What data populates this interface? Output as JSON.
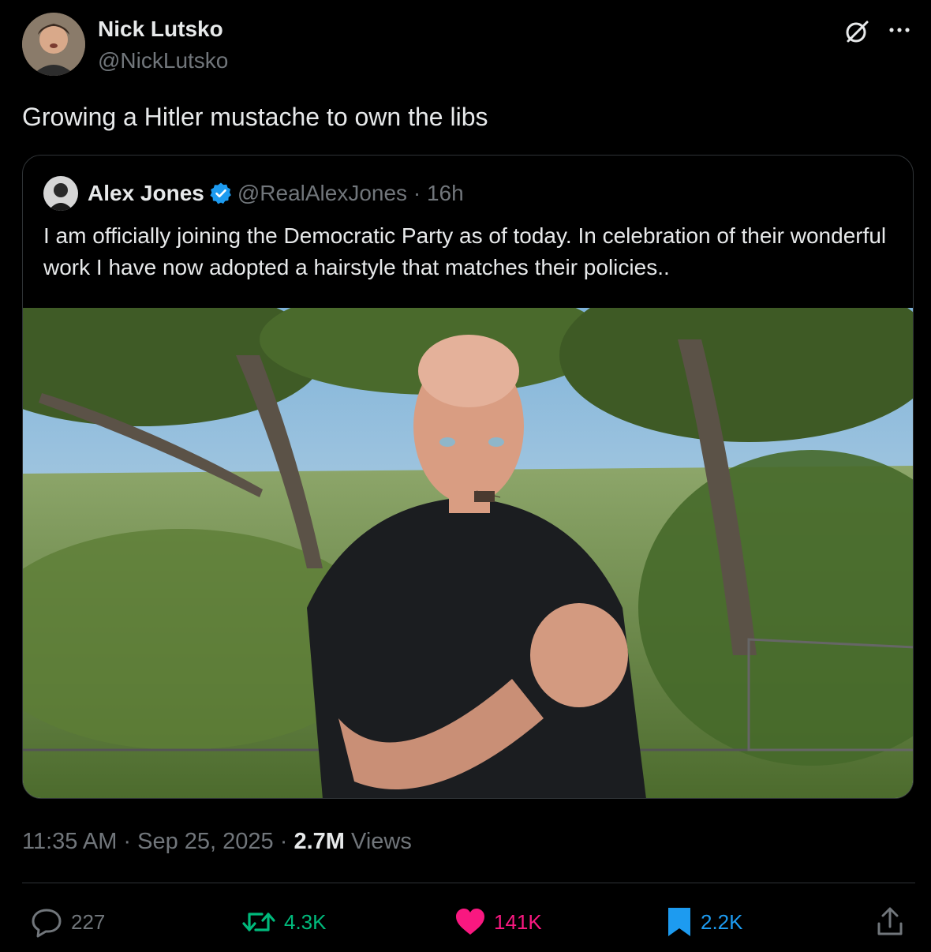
{
  "tweet": {
    "author_name": "Nick Lutsko",
    "author_handle": "@NickLutsko",
    "text": "Growing a Hitler mustache to own the libs",
    "timestamp": "11:35 AM · Sep 25, 2025 · ",
    "views_count": "2.7M",
    "views_label": " Views"
  },
  "quote": {
    "author_name": "Alex Jones",
    "author_handle": "@RealAlexJones",
    "separator": "·",
    "time": "16h",
    "text": "I am officially joining the Democratic Party as of today.  In celebration of their wonderful work I have now adopted a hairstyle that matches their policies.."
  },
  "actions": {
    "reply_count": "227",
    "retweet_count": "4.3K",
    "like_count": "141K",
    "bookmark_count": "2.2K"
  },
  "icons": {
    "grok": "grok-icon",
    "more": "more-icon",
    "verified": "verified-badge-icon",
    "reply": "reply-icon",
    "retweet": "retweet-icon",
    "like": "heart-icon",
    "bookmark": "bookmark-icon",
    "share": "share-icon"
  },
  "colors": {
    "background": "#000000",
    "text": "#e7e9ea",
    "muted": "#71767b",
    "retweet": "#00ba7c",
    "like": "#f91880",
    "bookmark": "#1d9bf0",
    "verified": "#1d9bf0"
  }
}
